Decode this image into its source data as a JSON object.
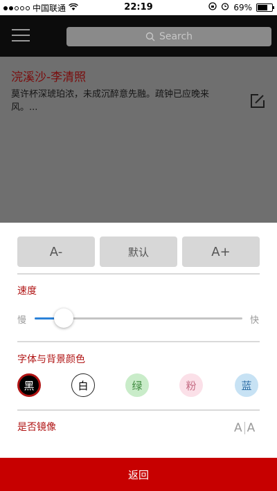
{
  "status_bar": {
    "carrier": "中国联通",
    "time": "22:19",
    "battery": "69%",
    "battery_level": 0.69
  },
  "header": {
    "menu_icon": "hamburger-menu-icon",
    "search_placeholder": "Search",
    "search_icon": "search-icon"
  },
  "poem": {
    "title": "浣溪沙-李清照",
    "text": "莫许杯深琥珀浓，未成沉醉意先融。疏钟已应晚来风。...",
    "edit_icon": "edit-icon"
  },
  "font_size": {
    "decrease": "A-",
    "default": "默认",
    "increase": "A+"
  },
  "speed": {
    "label": "速度",
    "min_label": "慢",
    "max_label": "快",
    "value_fraction": 0.14
  },
  "colors": {
    "label": "字体与背景颜色",
    "options": [
      {
        "label": "黑",
        "fg": "#ffffff",
        "bg": "#000000",
        "selected": true
      },
      {
        "label": "白",
        "fg": "#000000",
        "bg": "#ffffff",
        "selected": false
      },
      {
        "label": "绿",
        "fg": "#3f8a3f",
        "bg": "#c9ecc9",
        "selected": false
      },
      {
        "label": "粉",
        "fg": "#c46a82",
        "bg": "#fbe0e8",
        "selected": false
      },
      {
        "label": "蓝",
        "fg": "#2f6fa6",
        "bg": "#c7e2f4",
        "selected": false
      }
    ]
  },
  "mirror": {
    "label": "是否镜像",
    "icon_left": "A",
    "icon_right": "A"
  },
  "footer": {
    "back_label": "返回"
  },
  "theme": {
    "accent": "#c70000",
    "slider_accent": "#2b82d9"
  }
}
